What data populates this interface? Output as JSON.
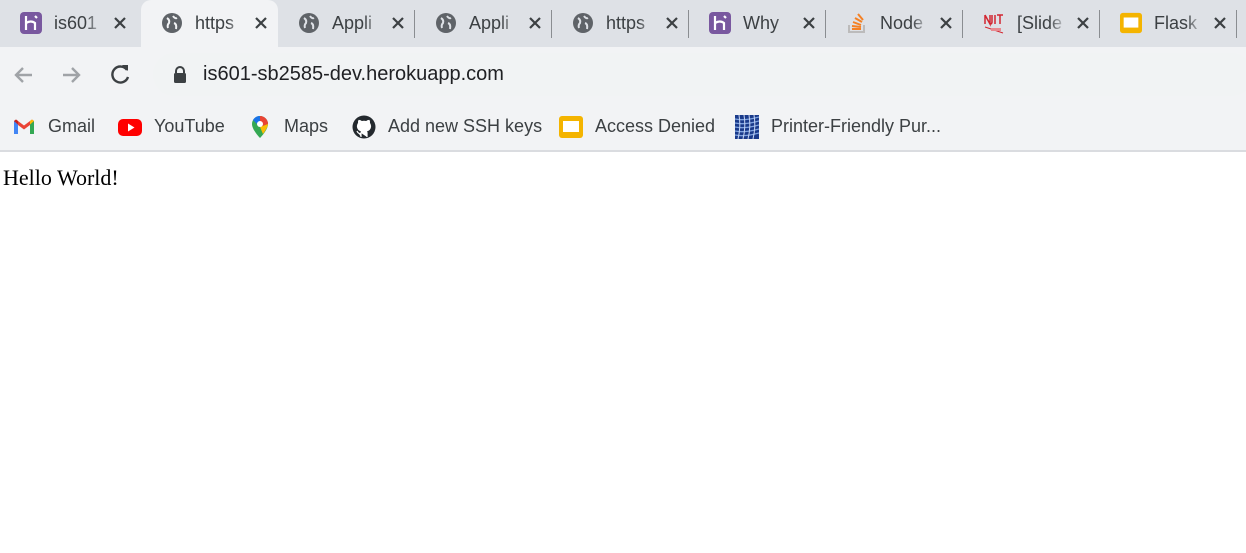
{
  "tabs": [
    {
      "title": "is601",
      "icon": "heroku-icon",
      "active": false
    },
    {
      "title": "https",
      "icon": "globe-icon",
      "active": true
    },
    {
      "title": "Appli",
      "icon": "globe-icon",
      "active": false
    },
    {
      "title": "Appli",
      "icon": "globe-icon",
      "active": false
    },
    {
      "title": "https",
      "icon": "globe-icon",
      "active": false
    },
    {
      "title": "Why",
      "icon": "heroku-icon",
      "active": false
    },
    {
      "title": "Node",
      "icon": "stackoverflow-icon",
      "active": false
    },
    {
      "title": "[Slide",
      "icon": "njit-icon",
      "active": false
    },
    {
      "title": "Flask",
      "icon": "google-slides-icon",
      "active": false
    }
  ],
  "toolbar": {
    "url": "is601-sb2585-dev.herokuapp.com"
  },
  "bookmarks": [
    {
      "label": "Gmail",
      "icon": "gmail-icon"
    },
    {
      "label": "YouTube",
      "icon": "youtube-icon"
    },
    {
      "label": "Maps",
      "icon": "maps-icon"
    },
    {
      "label": "Add new SSH keys",
      "icon": "github-icon"
    },
    {
      "label": "Access Denied",
      "icon": "google-slides-icon"
    },
    {
      "label": "Printer-Friendly Pur...",
      "icon": "united-icon"
    }
  ],
  "page": {
    "body_text": "Hello World!"
  },
  "colors": {
    "tabstrip": "#dee1e6",
    "active_tab": "#f2f3f5",
    "heroku_purple": "#79589f",
    "youtube_red": "#ff0000",
    "slides_yellow": "#f4b400"
  }
}
